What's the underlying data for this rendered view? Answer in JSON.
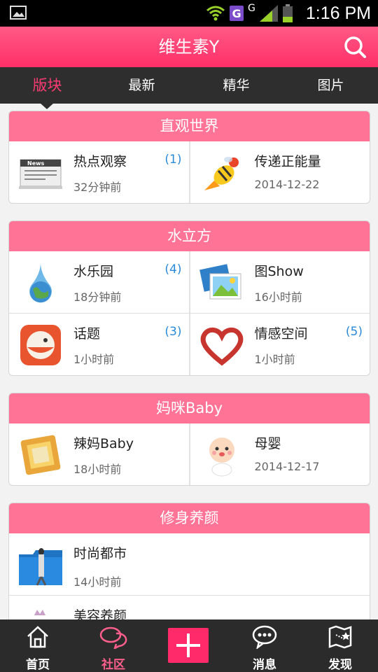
{
  "status_bar": {
    "time": "1:16 PM",
    "carrier_badge": "G",
    "network_letter": "G"
  },
  "title_bar": {
    "title": "维生素Y"
  },
  "tabs": [
    {
      "label": "版块",
      "active": true
    },
    {
      "label": "最新",
      "active": false
    },
    {
      "label": "精华",
      "active": false
    },
    {
      "label": "图片",
      "active": false
    }
  ],
  "sections": [
    {
      "title": "直观世界",
      "items": [
        {
          "name": "热点观察",
          "time": "32分钟前",
          "count": "(1)",
          "icon": "news-icon"
        },
        {
          "name": "传递正能量",
          "time": "2014-12-22",
          "count": "",
          "icon": "rocket-bee-icon"
        }
      ]
    },
    {
      "title": "水立方",
      "items": [
        {
          "name": "水乐园",
          "time": "18分钟前",
          "count": "(4)",
          "icon": "water-drop-globe-icon"
        },
        {
          "name": "图Show",
          "time": "16小时前",
          "count": "",
          "icon": "photos-icon"
        },
        {
          "name": "话题",
          "time": "1小时前",
          "count": "(3)",
          "icon": "chat-bird-icon"
        },
        {
          "name": "情感空间",
          "time": "1小时前",
          "count": "(5)",
          "icon": "heart-icon"
        }
      ]
    },
    {
      "title": "妈咪Baby",
      "items": [
        {
          "name": "辣妈Baby",
          "time": "18小时前",
          "count": "",
          "icon": "photo-frame-icon"
        },
        {
          "name": "母婴",
          "time": "2014-12-17",
          "count": "",
          "icon": "baby-icon"
        }
      ]
    },
    {
      "title": "修身养颜",
      "items": [
        {
          "name": "时尚都市",
          "time": "14小时前",
          "count": "",
          "icon": "fashion-folder-icon"
        },
        {
          "name": "美容养颜",
          "time": "",
          "count": "",
          "icon": "crown-icon"
        }
      ]
    }
  ],
  "bottom_nav": [
    {
      "label": "首页",
      "icon": "home-icon",
      "active": false
    },
    {
      "label": "社区",
      "icon": "chat-bubbles-icon",
      "active": true
    },
    {
      "label": "",
      "icon": "plus-icon",
      "active": false
    },
    {
      "label": "消息",
      "icon": "message-icon",
      "active": false
    },
    {
      "label": "发现",
      "icon": "map-flag-icon",
      "active": false
    }
  ],
  "colors": {
    "accent": "#ff2f68",
    "section_header": "#ff7396",
    "count_blue": "#2a8ad8",
    "tab_bar": "#2e2e2e"
  }
}
